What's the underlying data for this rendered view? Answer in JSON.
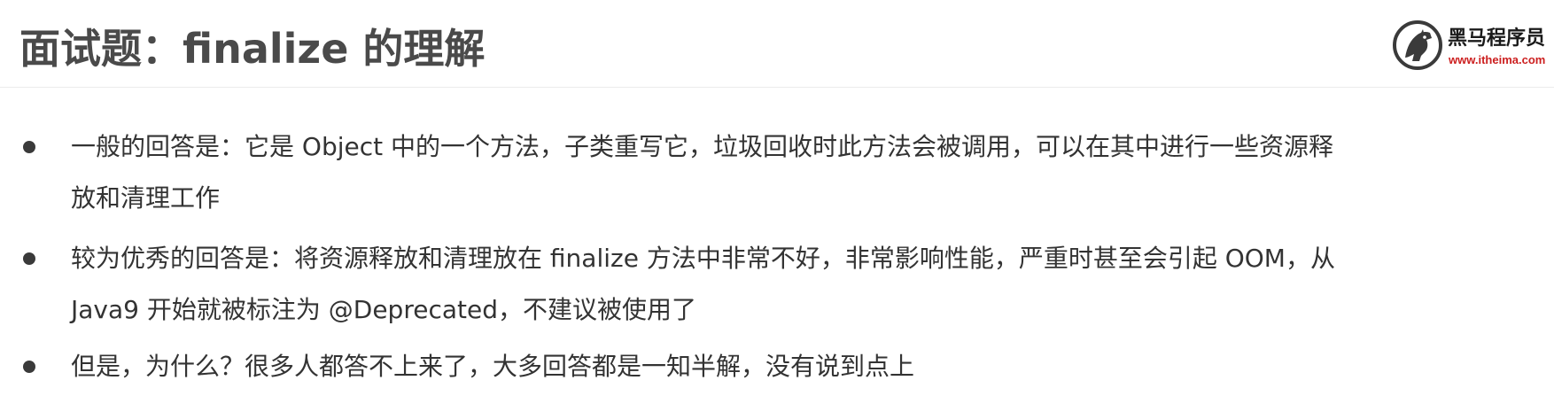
{
  "header": {
    "title": "面试题：finalize 的理解"
  },
  "logo": {
    "name_cn": "黑马程序员",
    "url": "www.itheima.com",
    "icon": "horse-head-logo-icon"
  },
  "bullets": [
    {
      "line1": "一般的回答是：它是 Object 中的一个方法，子类重写它，垃圾回收时此方法会被调用，可以在其中进行一些资源释",
      "line2": "放和清理工作"
    },
    {
      "line1": "较为优秀的回答是：将资源释放和清理放在 finalize 方法中非常不好，非常影响性能，严重时甚至会引起 OOM，从",
      "line2": "Java9 开始就被标注为 @Deprecated，不建议被使用了"
    },
    {
      "line1": "但是，为什么？很多人都答不上来了，大多回答都是一知半解，没有说到点上"
    }
  ],
  "colors": {
    "title": "#4a4a4a",
    "body_text": "#333333",
    "logo_url": "#cc1f1f",
    "bullet_dot": "#3a3a3a"
  }
}
